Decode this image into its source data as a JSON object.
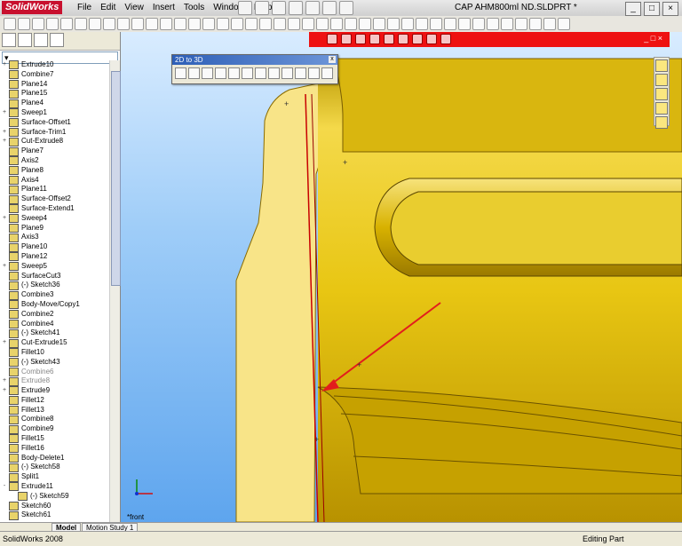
{
  "app": {
    "logo": "SolidWorks",
    "doc_title": "CAP AHM800ml ND.SLDPRT *"
  },
  "menu": [
    "File",
    "Edit",
    "View",
    "Insert",
    "Tools",
    "Window",
    "Help"
  ],
  "window_buttons": [
    "_",
    "□",
    "×"
  ],
  "float_toolbar": {
    "title": "2D to 3D",
    "close": "x"
  },
  "redbar_buttons": "_ □ ×",
  "tree": [
    {
      "label": "Extrude10",
      "exp": "+",
      "sub": false,
      "gray": false
    },
    {
      "label": "Combine7",
      "exp": "",
      "sub": false,
      "gray": false
    },
    {
      "label": "Plane14",
      "exp": "",
      "sub": false,
      "gray": false
    },
    {
      "label": "Plane15",
      "exp": "",
      "sub": false,
      "gray": false
    },
    {
      "label": "Plane4",
      "exp": "",
      "sub": false,
      "gray": false
    },
    {
      "label": "Sweep1",
      "exp": "+",
      "sub": false,
      "gray": false
    },
    {
      "label": "Surface-Offset1",
      "exp": "",
      "sub": false,
      "gray": false
    },
    {
      "label": "Surface-Trim1",
      "exp": "+",
      "sub": false,
      "gray": false
    },
    {
      "label": "Cut-Extrude8",
      "exp": "+",
      "sub": false,
      "gray": false
    },
    {
      "label": "Plane7",
      "exp": "",
      "sub": false,
      "gray": false
    },
    {
      "label": "Axis2",
      "exp": "",
      "sub": false,
      "gray": false
    },
    {
      "label": "Plane8",
      "exp": "",
      "sub": false,
      "gray": false
    },
    {
      "label": "Axis4",
      "exp": "",
      "sub": false,
      "gray": false
    },
    {
      "label": "Plane11",
      "exp": "",
      "sub": false,
      "gray": false
    },
    {
      "label": "Surface-Offset2",
      "exp": "",
      "sub": false,
      "gray": false
    },
    {
      "label": "Surface-Extend1",
      "exp": "",
      "sub": false,
      "gray": false
    },
    {
      "label": "Sweep4",
      "exp": "+",
      "sub": false,
      "gray": false
    },
    {
      "label": "Plane9",
      "exp": "",
      "sub": false,
      "gray": false
    },
    {
      "label": "Axis3",
      "exp": "",
      "sub": false,
      "gray": false
    },
    {
      "label": "Plane10",
      "exp": "",
      "sub": false,
      "gray": false
    },
    {
      "label": "Plane12",
      "exp": "",
      "sub": false,
      "gray": false
    },
    {
      "label": "Sweep5",
      "exp": "+",
      "sub": false,
      "gray": false
    },
    {
      "label": "SurfaceCut3",
      "exp": "",
      "sub": false,
      "gray": false
    },
    {
      "label": "(-) Sketch36",
      "exp": "",
      "sub": false,
      "gray": false
    },
    {
      "label": "Combine3",
      "exp": "",
      "sub": false,
      "gray": false
    },
    {
      "label": "Body-Move/Copy1",
      "exp": "",
      "sub": false,
      "gray": false
    },
    {
      "label": "Combine2",
      "exp": "",
      "sub": false,
      "gray": false
    },
    {
      "label": "Combine4",
      "exp": "",
      "sub": false,
      "gray": false
    },
    {
      "label": "(-) Sketch41",
      "exp": "",
      "sub": false,
      "gray": false
    },
    {
      "label": "Cut-Extrude15",
      "exp": "+",
      "sub": false,
      "gray": false
    },
    {
      "label": "Fillet10",
      "exp": "",
      "sub": false,
      "gray": false
    },
    {
      "label": "(-) Sketch43",
      "exp": "",
      "sub": false,
      "gray": false
    },
    {
      "label": "Combine6",
      "exp": "",
      "sub": false,
      "gray": true
    },
    {
      "label": "Extrude8",
      "exp": "+",
      "sub": false,
      "gray": true
    },
    {
      "label": "Extrude9",
      "exp": "+",
      "sub": false,
      "gray": false
    },
    {
      "label": "Fillet12",
      "exp": "",
      "sub": false,
      "gray": false
    },
    {
      "label": "Fillet13",
      "exp": "",
      "sub": false,
      "gray": false
    },
    {
      "label": "Combine8",
      "exp": "",
      "sub": false,
      "gray": false
    },
    {
      "label": "Combine9",
      "exp": "",
      "sub": false,
      "gray": false
    },
    {
      "label": "Fillet15",
      "exp": "",
      "sub": false,
      "gray": false
    },
    {
      "label": "Fillet16",
      "exp": "",
      "sub": false,
      "gray": false
    },
    {
      "label": "Body-Delete1",
      "exp": "",
      "sub": false,
      "gray": false
    },
    {
      "label": "(-) Sketch58",
      "exp": "",
      "sub": false,
      "gray": false
    },
    {
      "label": "Split1",
      "exp": "",
      "sub": false,
      "gray": false
    },
    {
      "label": "Extrude11",
      "exp": "-",
      "sub": false,
      "gray": false
    },
    {
      "label": "(-) Sketch59",
      "exp": "",
      "sub": true,
      "gray": false
    },
    {
      "label": "Sketch60",
      "exp": "",
      "sub": false,
      "gray": false
    },
    {
      "label": "Sketch61",
      "exp": "",
      "sub": false,
      "gray": false
    }
  ],
  "view_label": "*front",
  "bottom_tabs": {
    "model": "Model",
    "motion": "Motion Study 1"
  },
  "status": {
    "left": "SolidWorks 2008",
    "right": "Editing Part"
  },
  "colors": {
    "part": "#e6c200",
    "red_bar": "#e11111",
    "arrow": "#e21d1d"
  }
}
